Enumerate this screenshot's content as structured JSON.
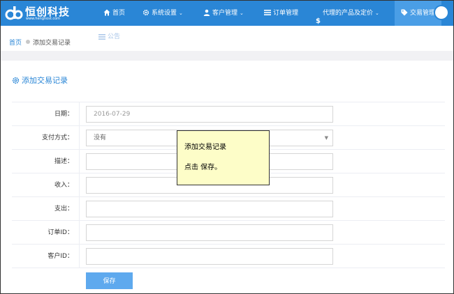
{
  "app": {
    "logo_text": "恒创科技",
    "logo_sub": "www.henghost.com"
  },
  "nav": {
    "items": [
      {
        "label": "首页",
        "icon": "home-icon"
      },
      {
        "label": "系统设置",
        "icon": "gear-icon",
        "has_caret": true
      },
      {
        "label": "客户管理",
        "icon": "user-icon",
        "has_caret": true
      },
      {
        "label": "订单管理",
        "icon": "list-icon"
      },
      {
        "label": "代理的产品及定价",
        "icon": "dollar-icon",
        "has_caret": true
      },
      {
        "label": "交易管理",
        "icon": "tag-icon",
        "active": true
      }
    ],
    "caret": "⌄",
    "submenu_label": "公告"
  },
  "breadcrumb": {
    "home": "首页",
    "current": "添加交易记录"
  },
  "section": {
    "title": "添加交易记录"
  },
  "form": {
    "date": {
      "label": "日期：",
      "value": "2016-07-29"
    },
    "payment": {
      "label": "支付方式：",
      "value": "没有",
      "arrow": "▼"
    },
    "desc": {
      "label": "描述：",
      "value": ""
    },
    "income": {
      "label": "收入：",
      "value": ""
    },
    "expense": {
      "label": "支出：",
      "value": ""
    },
    "order_id": {
      "label": "订单ID：",
      "value": ""
    },
    "customer_id": {
      "label": "客户ID：",
      "value": ""
    },
    "save_label": "保存"
  },
  "tooltip": {
    "line1": "添加交易记录",
    "line2": "点击 保存。"
  },
  "colors": {
    "brand": "#2a86d6",
    "button": "#5ea9ee",
    "tooltip_bg": "#fdfdc8"
  }
}
